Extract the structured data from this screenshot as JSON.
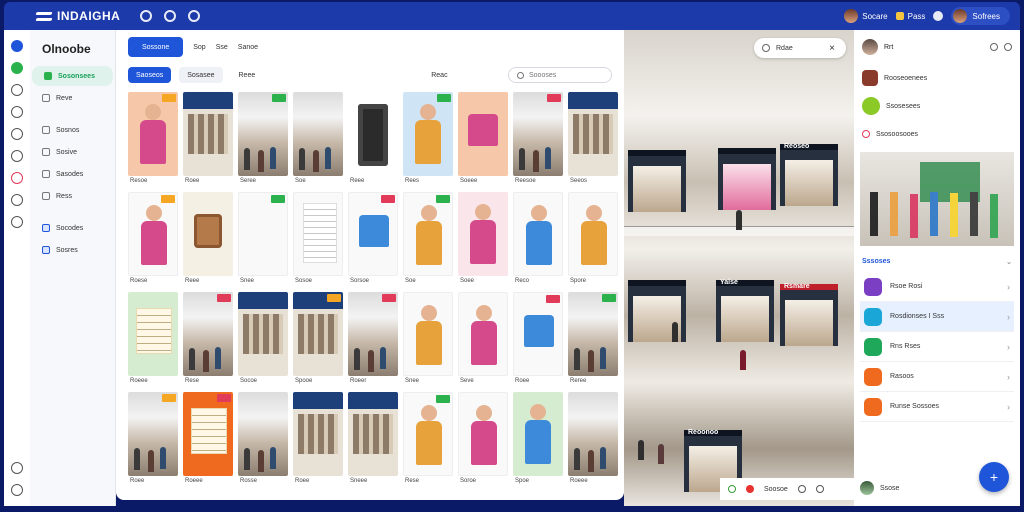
{
  "app": {
    "title": "INDAIGHA"
  },
  "topbar": {
    "items": [
      {
        "label": "Socare"
      },
      {
        "label": "Pass"
      },
      {
        "label": "Sofrees"
      }
    ]
  },
  "nav": {
    "title": "Olnoobe",
    "items": [
      {
        "label": "Sosonsees"
      },
      {
        "label": "Reve"
      },
      {
        "label": "Sosnos"
      },
      {
        "label": "Sosive"
      },
      {
        "label": "Sasodes"
      },
      {
        "label": "Ress"
      },
      {
        "label": "Socodes"
      },
      {
        "label": "Sosres"
      }
    ]
  },
  "toolbar": {
    "primary": "Sossone",
    "link1": "Sop",
    "link2": "Sse",
    "link3": "Sanoe"
  },
  "filters": {
    "chips": [
      "Saoseos",
      "Sosasee",
      "Reee"
    ],
    "label": "Reac",
    "search_placeholder": "Soooses"
  },
  "grid": {
    "captions": [
      "Resoe",
      "Roee",
      "Seree",
      "Soe",
      "Reee",
      "Rees",
      "Soeee",
      "Reesoe",
      "Seeos",
      "Roese",
      "Reee",
      "Snee",
      "Sosoe",
      "Sorsoe",
      "Soe",
      "Soee",
      "Reco",
      "Spore",
      "Roeee",
      "Rese",
      "Socoe",
      "Spooe",
      "Roeer",
      "Snee",
      "Seve",
      "Roee",
      "Reree",
      "Roee",
      "Roeee",
      "Rosse",
      "Roee",
      "Sneee",
      "Rese",
      "Soroe",
      "Spoe",
      "Roeee"
    ]
  },
  "photo": {
    "toolbar_label": "Rdae",
    "store_labels": [
      "Reoseo",
      "Reoonoo",
      "Yalse",
      "Rsmare"
    ],
    "bottom_label": "Soosoe"
  },
  "right": {
    "header_label": "Rrt",
    "rows": [
      "Rooseoenees",
      "Ssosesees",
      "Ssosoosooes"
    ],
    "section": "Sssoses",
    "apps": [
      {
        "label": "Rsoe Rosi",
        "color": "#7b3fc4"
      },
      {
        "label": "Rosdionses I Sss",
        "color": "#1aa6d6"
      },
      {
        "label": "Rns Rses",
        "color": "#1fa85a"
      },
      {
        "label": "Rasoos",
        "color": "#ef6a1e"
      },
      {
        "label": "Runse Sossoes",
        "color": "#ef6a1e"
      }
    ],
    "footer_label": "Ssose"
  },
  "colors": {
    "accent": "#1f55d9",
    "topbar": "#1c3aa9",
    "success": "#2bb24c"
  }
}
